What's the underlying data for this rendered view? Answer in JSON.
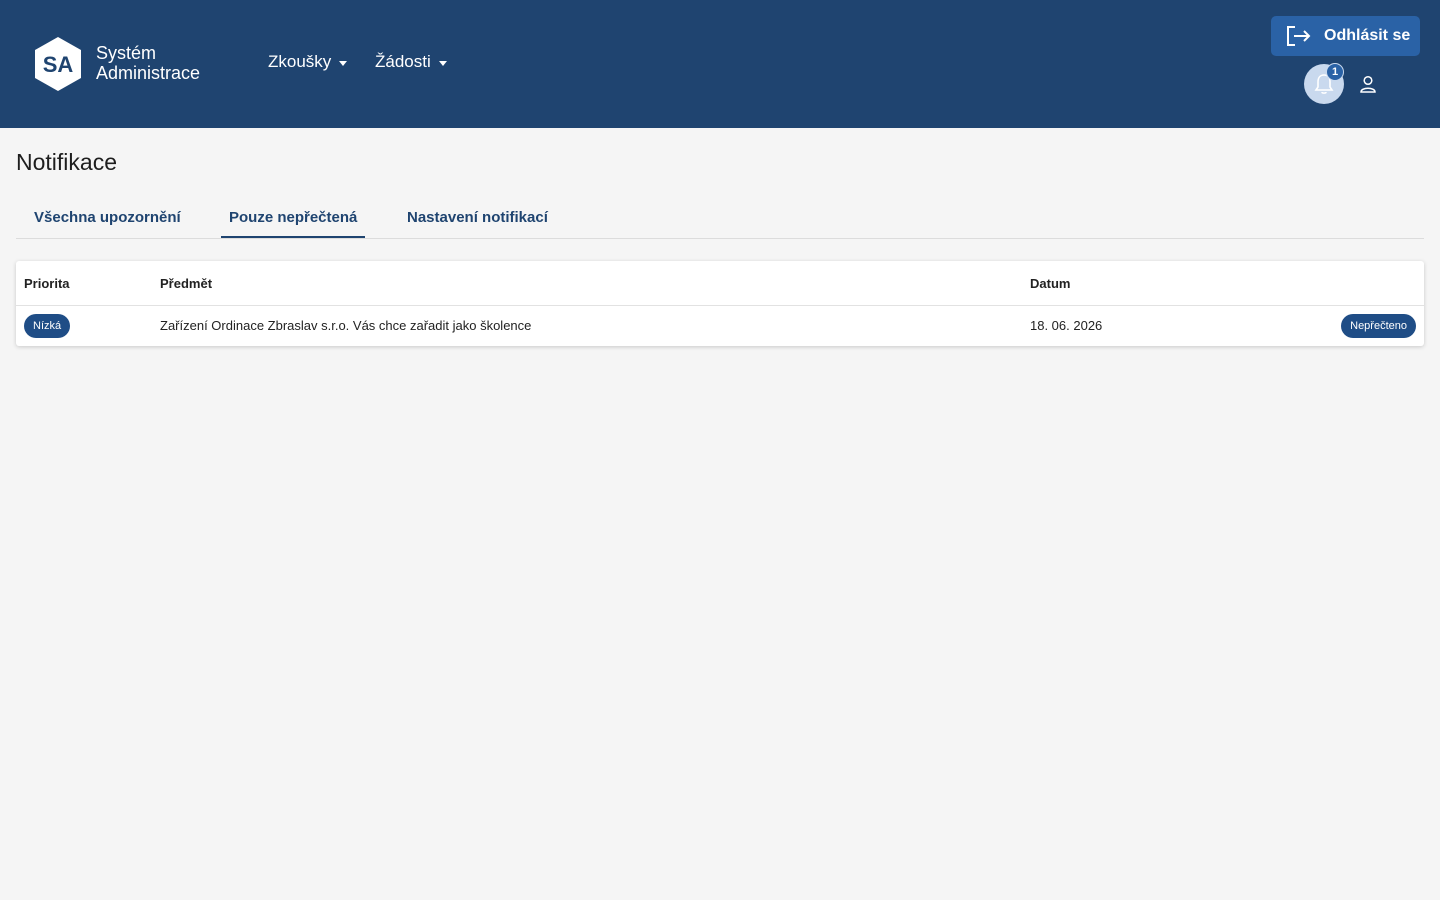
{
  "brand": {
    "logo_letters": "SA",
    "line1": "Systém",
    "line2": "Administrace"
  },
  "nav": {
    "items": [
      {
        "label": "Zkoušky"
      },
      {
        "label": "Žádosti"
      }
    ]
  },
  "header_actions": {
    "logout_label": "Odhlásit se",
    "notification_count": "1"
  },
  "page": {
    "title": "Notifikace"
  },
  "tabs": [
    {
      "label": "Všechna upozornění",
      "active": false
    },
    {
      "label": "Pouze nepřečtená",
      "active": true
    },
    {
      "label": "Nastavení notifikací",
      "active": false
    }
  ],
  "table": {
    "columns": {
      "priority": "Priorita",
      "subject": "Předmět",
      "date": "Datum"
    },
    "rows": [
      {
        "priority": "Nízká",
        "subject": "Zařízení Ordinace Zbraslav s.r.o. Vás chce zařadit jako školence",
        "date": "18. 06. 2026",
        "status": "Nepřečteno"
      }
    ]
  },
  "colors": {
    "header_bg": "#1f4470",
    "accent": "#2a62a6",
    "badge": "#1f4d86",
    "page_bg": "#f5f5f5"
  }
}
